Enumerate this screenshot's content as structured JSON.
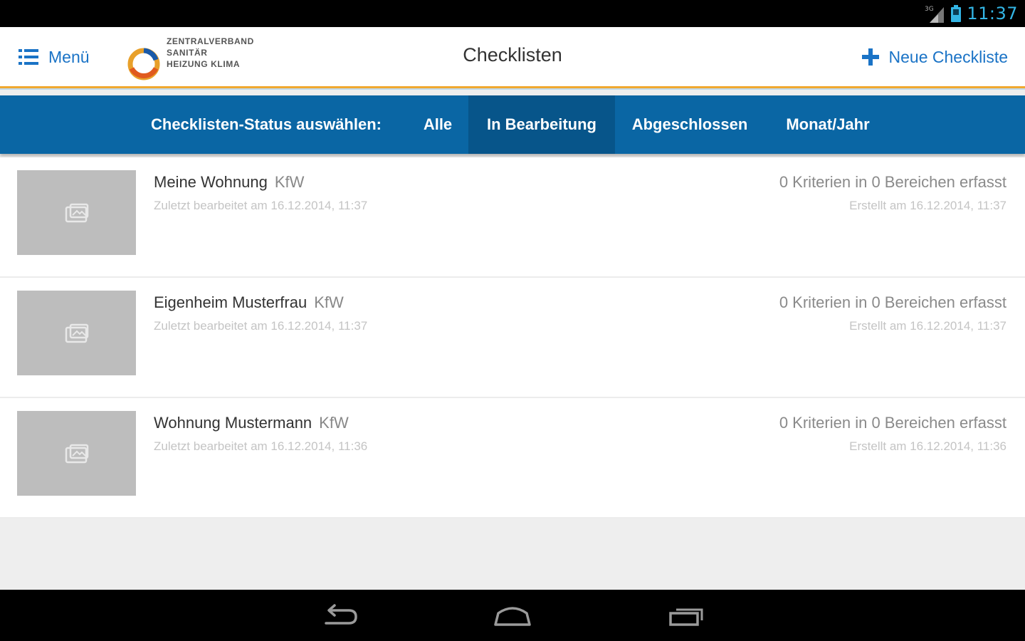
{
  "status_bar": {
    "network": "3G",
    "time": "11:37"
  },
  "header": {
    "menu_label": "Menü",
    "logo_lines": [
      "ZENTRALVERBAND",
      "SANITÄR",
      "HEIZUNG KLIMA"
    ],
    "title": "Checklisten",
    "new_label": "Neue Checkliste"
  },
  "filter": {
    "label": "Checklisten-Status auswählen:",
    "tabs": [
      {
        "label": "Alle",
        "active": false
      },
      {
        "label": "In Bearbeitung",
        "active": true
      },
      {
        "label": "Abgeschlossen",
        "active": false
      },
      {
        "label": "Monat/Jahr",
        "active": false
      }
    ]
  },
  "checklists": [
    {
      "name": "Meine Wohnung",
      "tag": "KfW",
      "edited": "Zuletzt bearbeitet am 16.12.2014, 11:37",
      "criteria": "0 Kriterien in 0 Bereichen erfasst",
      "created": "Erstellt am 16.12.2014, 11:37"
    },
    {
      "name": "Eigenheim Musterfrau",
      "tag": "KfW",
      "edited": "Zuletzt bearbeitet am 16.12.2014, 11:37",
      "criteria": "0 Kriterien in 0 Bereichen erfasst",
      "created": "Erstellt am 16.12.2014, 11:37"
    },
    {
      "name": "Wohnung Mustermann",
      "tag": "KfW",
      "edited": "Zuletzt bearbeitet am 16.12.2014, 11:36",
      "criteria": "0 Kriterien in 0 Bereichen erfasst",
      "created": "Erstellt am 16.12.2014, 11:36"
    }
  ],
  "icons": {
    "menu": "list-icon",
    "add": "plus-icon",
    "thumbnail": "image-placeholder-icon",
    "nav": [
      "back-icon",
      "home-icon",
      "recent-apps-icon"
    ]
  },
  "colors": {
    "accent": "#1a73c6",
    "filter_bar": "#0a66a4",
    "filter_active": "#07558a",
    "status_time": "#33b5e5"
  }
}
